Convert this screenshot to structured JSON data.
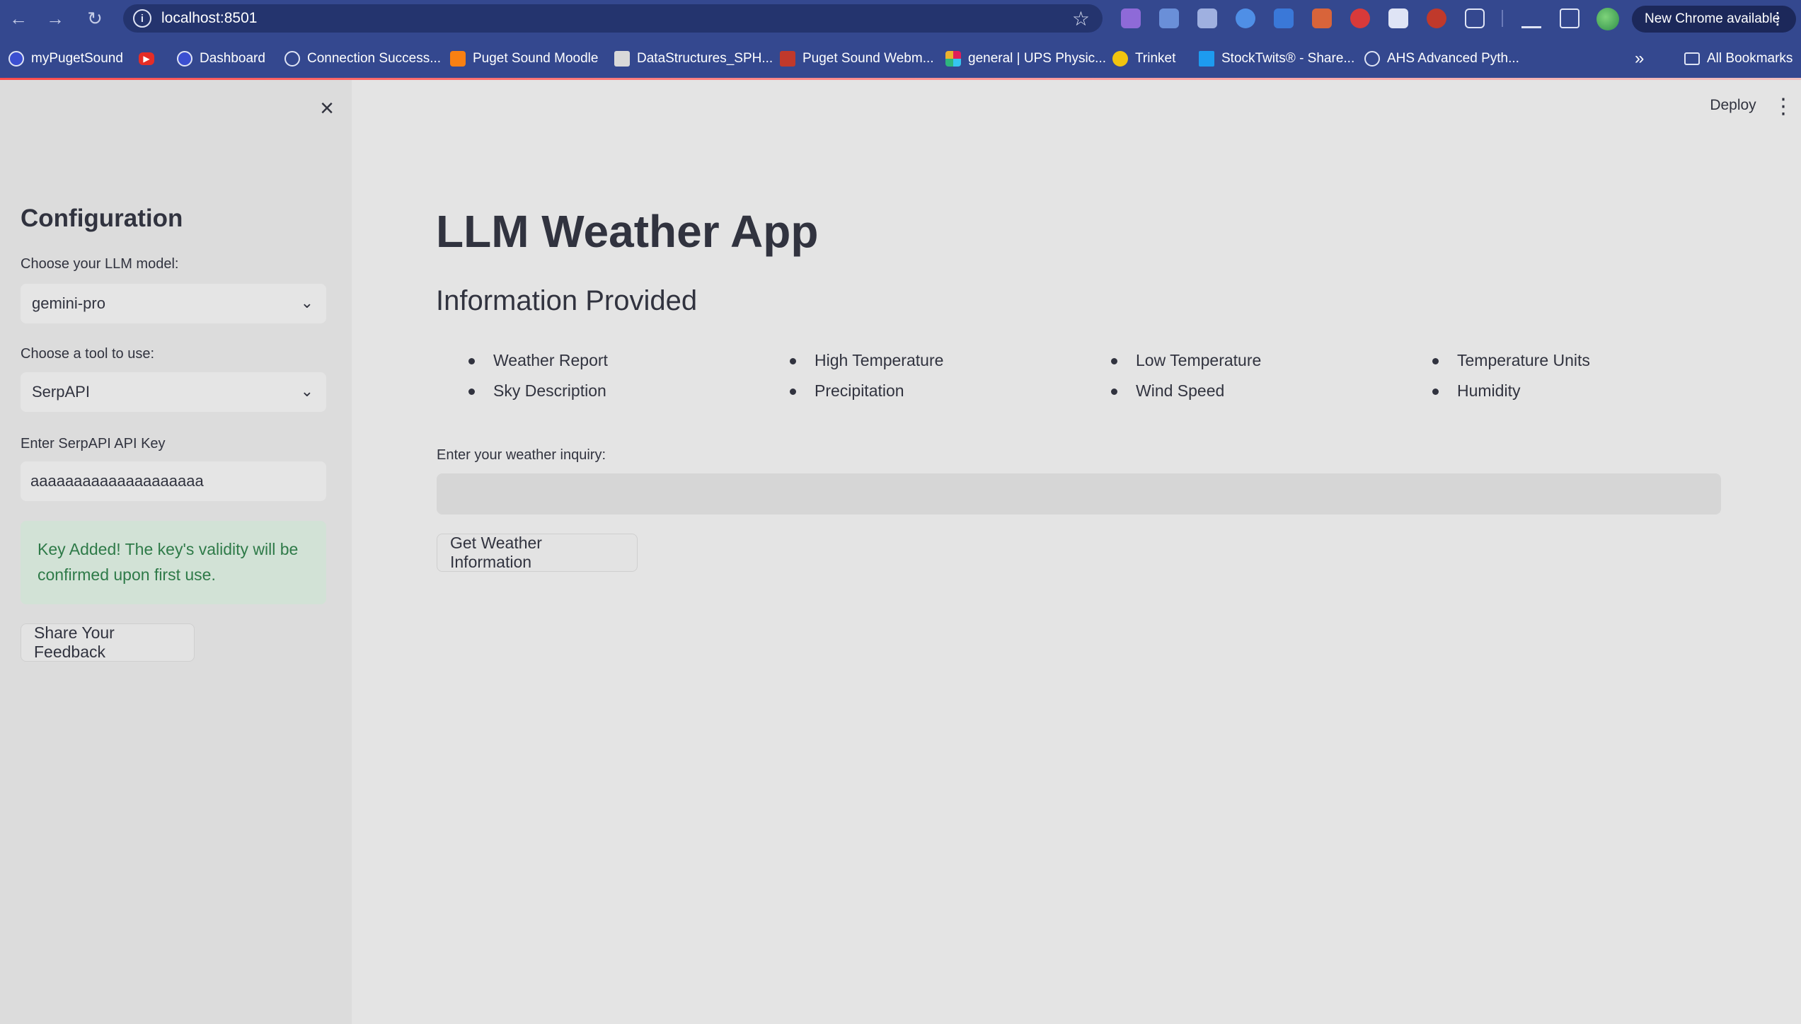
{
  "browser": {
    "url": "localhost:8501",
    "update_label": "New Chrome available",
    "bookmarks": [
      {
        "label": "myPugetSound",
        "icon": "puget-sound-icon",
        "color": "#3b4fd1"
      },
      {
        "label": "",
        "icon": "youtube-icon",
        "color": "#e52d27"
      },
      {
        "label": "Dashboard",
        "icon": "dashboard-icon",
        "color": "#3b4fd1"
      },
      {
        "label": "Connection Success...",
        "icon": "globe-icon",
        "color": "#dfe4f5"
      },
      {
        "label": "Puget Sound Moodle",
        "icon": "moodle-icon",
        "color": "#f98012"
      },
      {
        "label": "DataStructures_SPH...",
        "icon": "image-icon",
        "color": "#d9d9d9"
      },
      {
        "label": "Puget Sound Webm...",
        "icon": "outlook-icon",
        "color": "#c0392b"
      },
      {
        "label": "general | UPS Physic...",
        "icon": "slack-icon",
        "color": "#e01e5a"
      },
      {
        "label": "Trinket",
        "icon": "trinket-icon",
        "color": "#f1c40f"
      },
      {
        "label": "StockTwits® - Share...",
        "icon": "stocktwits-icon",
        "color": "#1d9bf0"
      },
      {
        "label": "AHS Advanced Pyth...",
        "icon": "globe-icon",
        "color": "#dfe4f5"
      }
    ],
    "all_bookmarks_label": "All Bookmarks"
  },
  "sidebar": {
    "title": "Configuration",
    "model_label": "Choose your LLM model:",
    "model_value": "gemini-pro",
    "tool_label": "Choose a tool to use:",
    "tool_value": "SerpAPI",
    "api_key_label": "Enter SerpAPI API Key",
    "api_key_value": "aaaaaaaaaaaaaaaaaaaa",
    "success_message": "Key Added! The key's validity will be confirmed upon first use.",
    "feedback_button": "Share Your Feedback"
  },
  "header": {
    "deploy_label": "Deploy"
  },
  "main": {
    "title": "LLM Weather App",
    "subtitle": "Information Provided",
    "info_columns": [
      [
        "Weather Report",
        "Sky Description"
      ],
      [
        "High Temperature",
        "Precipitation"
      ],
      [
        "Low Temperature",
        "Wind Speed"
      ],
      [
        "Temperature Units",
        "Humidity"
      ]
    ],
    "inquiry_label": "Enter your weather inquiry:",
    "inquiry_value": "",
    "submit_button": "Get Weather Information"
  },
  "colors": {
    "chrome_toolbar": "#34488f",
    "sidebar_bg": "#dcdcdc",
    "main_bg": "#e4e4e4",
    "text": "#31333f",
    "success_bg": "#d2e2d6",
    "success_text": "#2e7a48"
  }
}
